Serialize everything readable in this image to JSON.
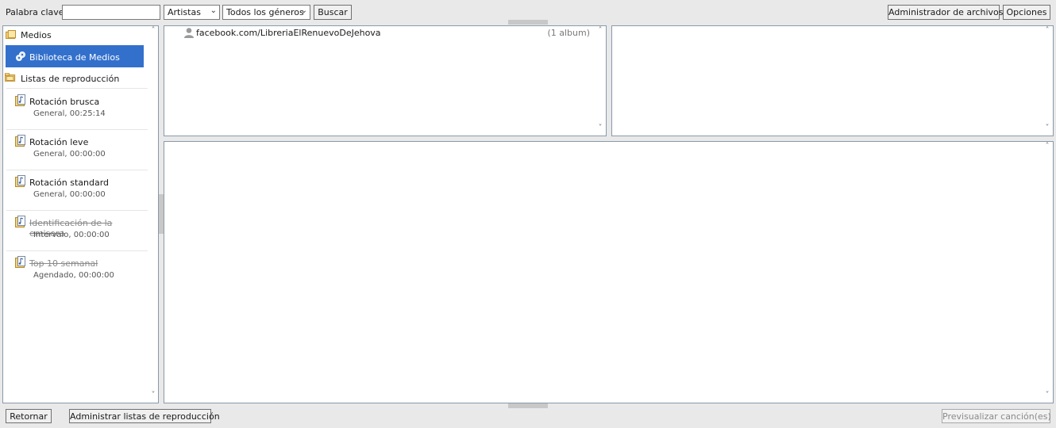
{
  "toolbar": {
    "keyword_label": "Palabra clave:",
    "keyword_value": "",
    "type_select": "Artistas",
    "genre_select": "Todos los géneros",
    "search_button": "Buscar",
    "file_manager_button": "Administrador de archivos",
    "options_button": "Opciones"
  },
  "sidebar": {
    "media_section": "Medios",
    "media_library": "Biblioteca de Medios",
    "playlists_section": "Listas de reproducción",
    "playlists": [
      {
        "name": "Rotación brusca",
        "detail": "General, 00:25:14",
        "disabled": false
      },
      {
        "name": "Rotación leve",
        "detail": "General, 00:00:00",
        "disabled": false
      },
      {
        "name": "Rotación standard",
        "detail": "General, 00:00:00",
        "disabled": false
      },
      {
        "name": "Identificación de la emisora",
        "detail": "Intervalo, 00:00:00",
        "disabled": true
      },
      {
        "name": "Top 10 semanal",
        "detail": "Agendado, 00:00:00",
        "disabled": true
      }
    ]
  },
  "artists_panel": {
    "items": [
      {
        "name": "facebook.com/LibreriaElRenuevoDeJehova",
        "count": "(1 album)"
      }
    ]
  },
  "footer": {
    "return_button": "Retornar",
    "manage_playlists_button": "Administrar listas de reproducción",
    "preview_button": "Previsualizar canción(es)"
  },
  "colors": {
    "selection": "#3370cc",
    "panel_border": "#8a9aa8",
    "background": "#e9e9e9"
  }
}
